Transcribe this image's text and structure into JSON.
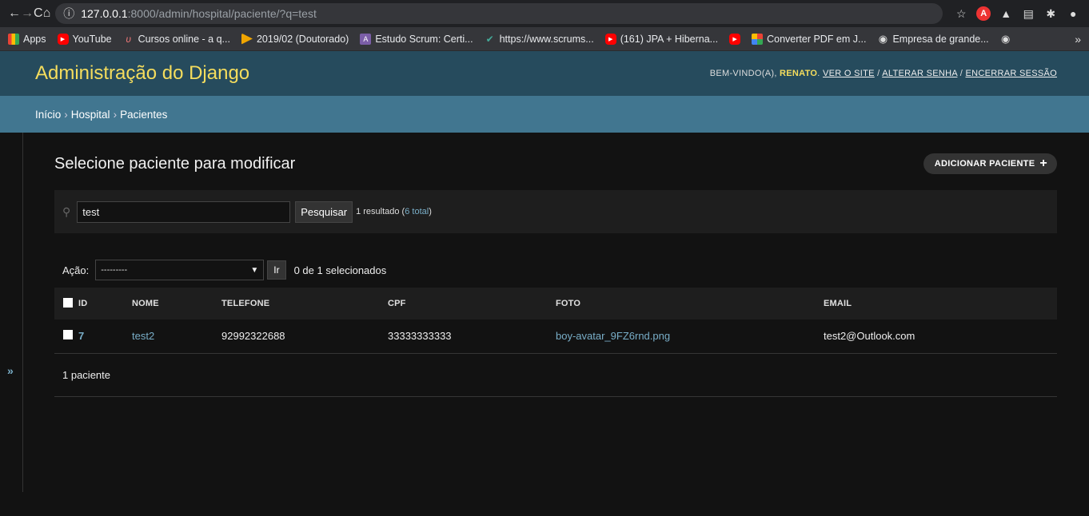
{
  "browser": {
    "url_host": "127.0.0.1",
    "url_path": ":8000/admin/hospital/paciente/?q=test",
    "bookmarks": [
      {
        "label": "Apps"
      },
      {
        "label": "YouTube"
      },
      {
        "label": "Cursos online - a q..."
      },
      {
        "label": "2019/02 (Doutorado)"
      },
      {
        "label": "Estudo Scrum: Certi..."
      },
      {
        "label": "https://www.scrums..."
      },
      {
        "label": "(161) JPA + Hiberna..."
      },
      {
        "label": ""
      },
      {
        "label": "Converter PDF em J..."
      },
      {
        "label": "Empresa de grande..."
      }
    ]
  },
  "header": {
    "brand": "Administração do Django",
    "welcome": "BEM-VINDO(A),",
    "user": "RENATO",
    "view_site": "VER O SITE",
    "change_password": "ALTERAR SENHA",
    "logout": "ENCERRAR SESSÃO"
  },
  "breadcrumbs": {
    "home": "Início",
    "app": "Hospital",
    "model": "Pacientes"
  },
  "page": {
    "title": "Selecione paciente para modificar",
    "add_button": "ADICIONAR PACIENTE"
  },
  "search": {
    "value": "test",
    "button": "Pesquisar",
    "result_prefix": "1 resultado (",
    "total_link": "6 total",
    "result_suffix": ")"
  },
  "actions": {
    "label": "Ação:",
    "selected_option": "---------",
    "go": "Ir",
    "counter": "0 de 1 selecionados"
  },
  "table": {
    "headers": [
      "ID",
      "NOME",
      "TELEFONE",
      "CPF",
      "FOTO",
      "EMAIL"
    ],
    "rows": [
      {
        "id": "7",
        "nome": "test2",
        "telefone": "92992322688",
        "cpf": "33333333333",
        "foto": "boy-avatar_9FZ6rnd.png",
        "email": "test2@Outlook.com"
      }
    ]
  },
  "footer": {
    "count": "1 paciente"
  }
}
